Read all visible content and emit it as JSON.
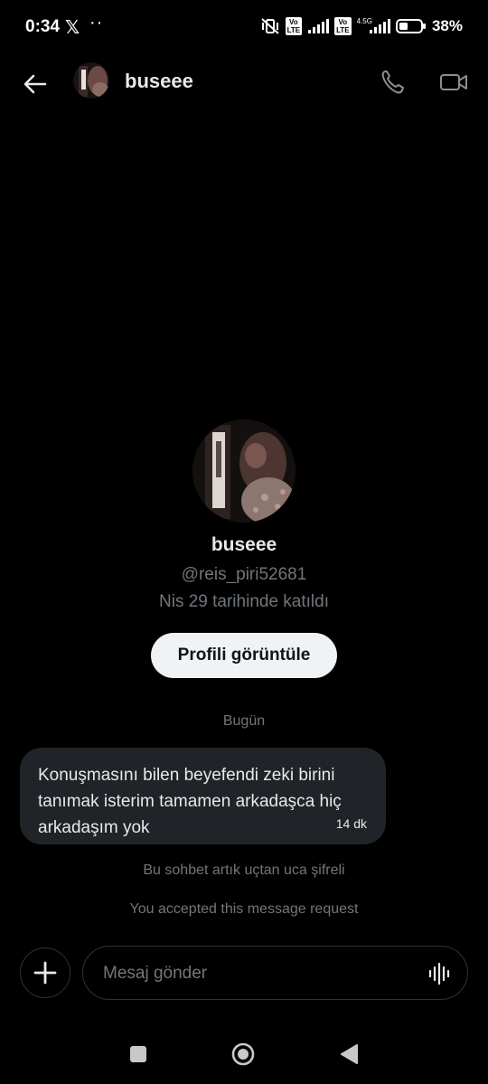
{
  "status_bar": {
    "time": "0:34",
    "app_icon": "x-logo",
    "extra": "··",
    "network_badge": "4.5G",
    "volte_label": "Vo LTE",
    "battery_pct": "38%"
  },
  "header": {
    "name": "buseee",
    "icons": [
      "back-arrow-icon",
      "phone-icon",
      "video-icon"
    ]
  },
  "profile": {
    "name": "buseee",
    "handle": "@reis_piri52681",
    "joined": "Nis 29 tarihinde katıldı",
    "view_button": "Profili görüntüle"
  },
  "conversation": {
    "day_label": "Bugün",
    "messages": [
      {
        "text": "Konuşmasını bilen beyefendi zeki birini tanımak isterim tamamen arkadaşca hiç arkadaşım yok",
        "time": "14 dk"
      }
    ],
    "encryption_note": "Bu sohbet artık uçtan uca şifreli",
    "request_note": "You accepted this message request"
  },
  "composer": {
    "placeholder": "Mesaj gönder",
    "icons": [
      "plus-icon",
      "voice-wave-icon"
    ]
  },
  "colors": {
    "background": "#000000",
    "bubble": "#202327",
    "secondary_text": "#71767b",
    "primary_text": "#e7e9ea",
    "button_bg": "#eff3f4"
  }
}
